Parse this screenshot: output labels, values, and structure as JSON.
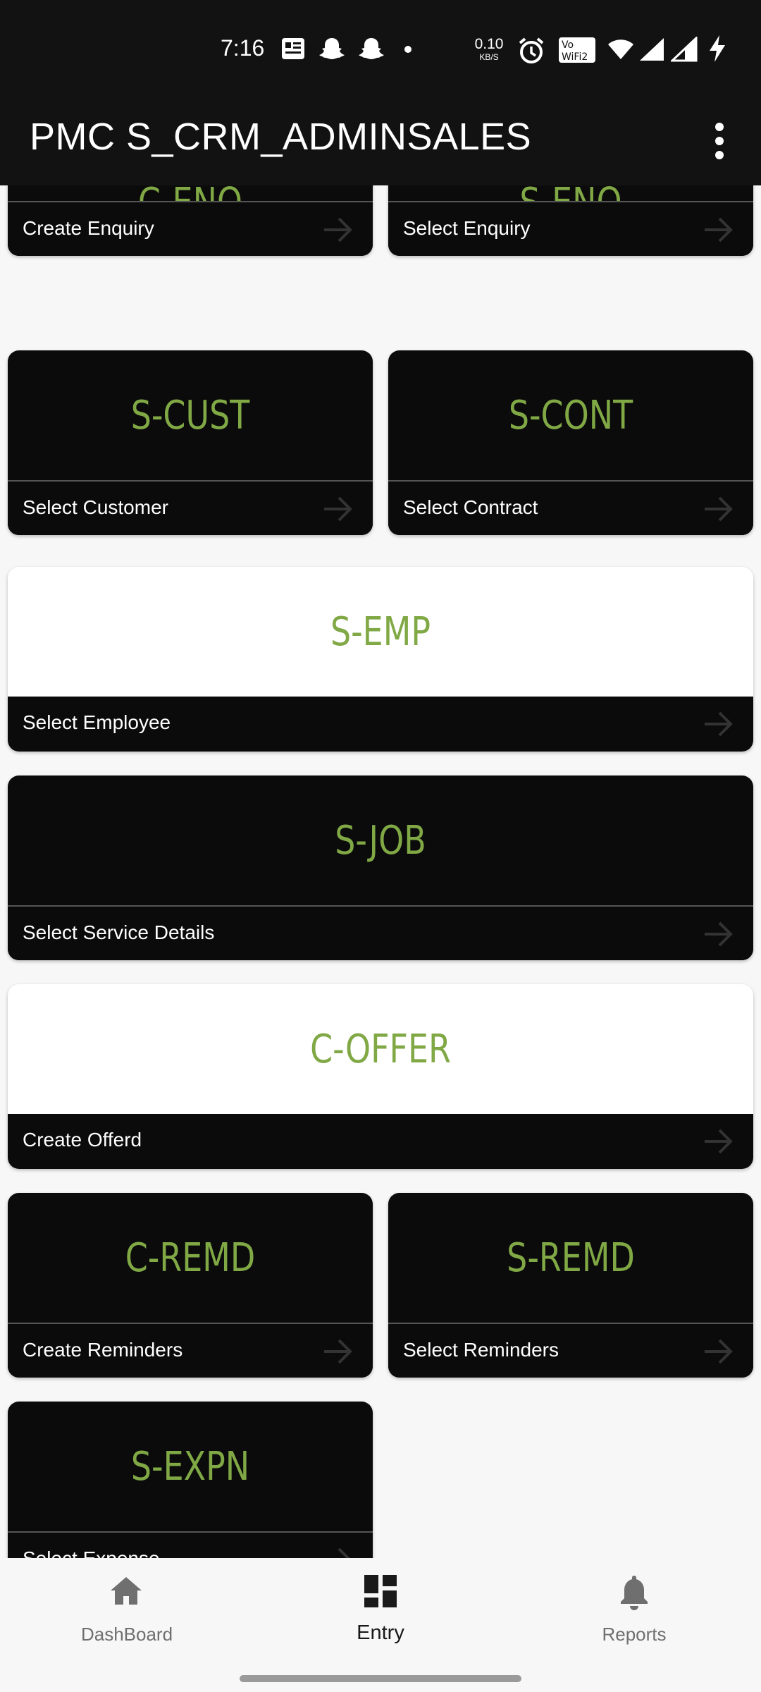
{
  "status_bar": {
    "time": "7:16",
    "net_speed_value": "0.10",
    "net_speed_unit": "KB/S",
    "wifi_badge": "Vo WiFi 2"
  },
  "app_bar": {
    "title": "PMC S_CRM_ADMINSALES",
    "menu_icon": "more-vert-icon"
  },
  "cards": [
    {
      "code": "C-ENQ",
      "label": "Create Enquiry",
      "style": "dark"
    },
    {
      "code": "S-ENQ",
      "label": "Select Enquiry",
      "style": "dark"
    },
    {
      "code": "S-CUST",
      "label": "Select Customer",
      "style": "dark"
    },
    {
      "code": "S-CONT",
      "label": "Select Contract",
      "style": "dark"
    },
    {
      "code": "S-EMP",
      "label": "Select Employee",
      "style": "light"
    },
    {
      "code": "S-JOB",
      "label": "Select Service Details",
      "style": "dark"
    },
    {
      "code": "C-OFFER",
      "label": "Create Offerd",
      "style": "light"
    },
    {
      "code": "C-REMD",
      "label": "Create Reminders",
      "style": "dark"
    },
    {
      "code": "S-REMD",
      "label": "Select Reminders",
      "style": "dark"
    },
    {
      "code": "S-EXPN",
      "label": "Select Expense",
      "style": "dark"
    }
  ],
  "bottom_nav": {
    "items": [
      {
        "label": "DashBoard",
        "icon": "home-icon",
        "active": false
      },
      {
        "label": "Entry",
        "icon": "grid-icon",
        "active": true
      },
      {
        "label": "Reports",
        "icon": "bell-icon",
        "active": false
      }
    ]
  },
  "colors": {
    "accent_green": "#80a845",
    "card_dark": "#0b0b0b",
    "bar_dark": "#121212"
  }
}
